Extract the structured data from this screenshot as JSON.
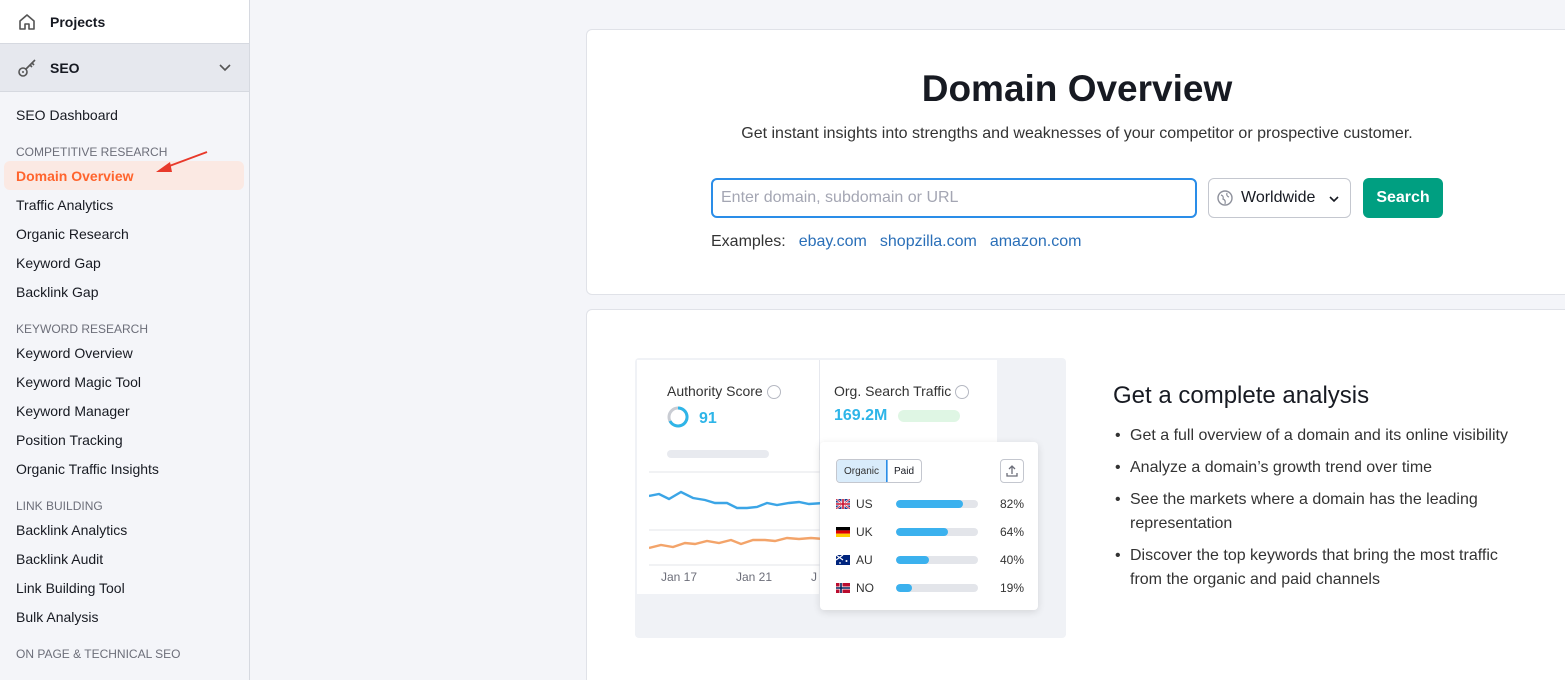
{
  "sidebar": {
    "projects_label": "Projects",
    "seo_label": "SEO",
    "dashboard_label": "SEO Dashboard",
    "sections": [
      {
        "title": "COMPETITIVE RESEARCH",
        "items": [
          "Domain Overview",
          "Traffic Analytics",
          "Organic Research",
          "Keyword Gap",
          "Backlink Gap"
        ]
      },
      {
        "title": "KEYWORD RESEARCH",
        "items": [
          "Keyword Overview",
          "Keyword Magic Tool",
          "Keyword Manager",
          "Position Tracking",
          "Organic Traffic Insights"
        ]
      },
      {
        "title": "LINK BUILDING",
        "items": [
          "Backlink Analytics",
          "Backlink Audit",
          "Link Building Tool",
          "Bulk Analysis"
        ]
      },
      {
        "title": "ON PAGE & TECHNICAL SEO",
        "items": []
      }
    ],
    "active_item": "Domain Overview"
  },
  "hero": {
    "title": "Domain Overview",
    "subtitle": "Get instant insights into strengths and weaknesses of your competitor or prospective customer.",
    "search_placeholder": "Enter domain, subdomain or URL",
    "database": "Worldwide",
    "search_button": "Search",
    "examples_label": "Examples:",
    "examples": [
      "ebay.com",
      "shopzilla.com",
      "amazon.com"
    ]
  },
  "illustration": {
    "authority_label": "Authority Score",
    "authority_value": "91",
    "traffic_label": "Org. Search Traffic",
    "traffic_value": "169.2M",
    "toggle_organic": "Organic",
    "toggle_paid": "Paid",
    "countries": [
      {
        "code": "US",
        "pct": "82%",
        "value": 82
      },
      {
        "code": "UK",
        "pct": "64%",
        "value": 64
      },
      {
        "code": "AU",
        "pct": "40%",
        "value": 40
      },
      {
        "code": "NO",
        "pct": "19%",
        "value": 19
      }
    ],
    "x_labels": [
      "Jan 17",
      "Jan 21",
      "J"
    ]
  },
  "analysis": {
    "title": "Get a complete analysis",
    "bullets": [
      "Get a full overview of a domain and its online visibility",
      "Analyze a domain’s growth trend over time",
      "See the markets where a domain has the leading representation",
      "Discover the top keywords that bring the most traffic from the organic and paid channels"
    ]
  },
  "colors": {
    "accent": "#ff642d",
    "primary_button": "#009f81",
    "link": "#2a6fb8",
    "metric": "#2eb5e8"
  }
}
